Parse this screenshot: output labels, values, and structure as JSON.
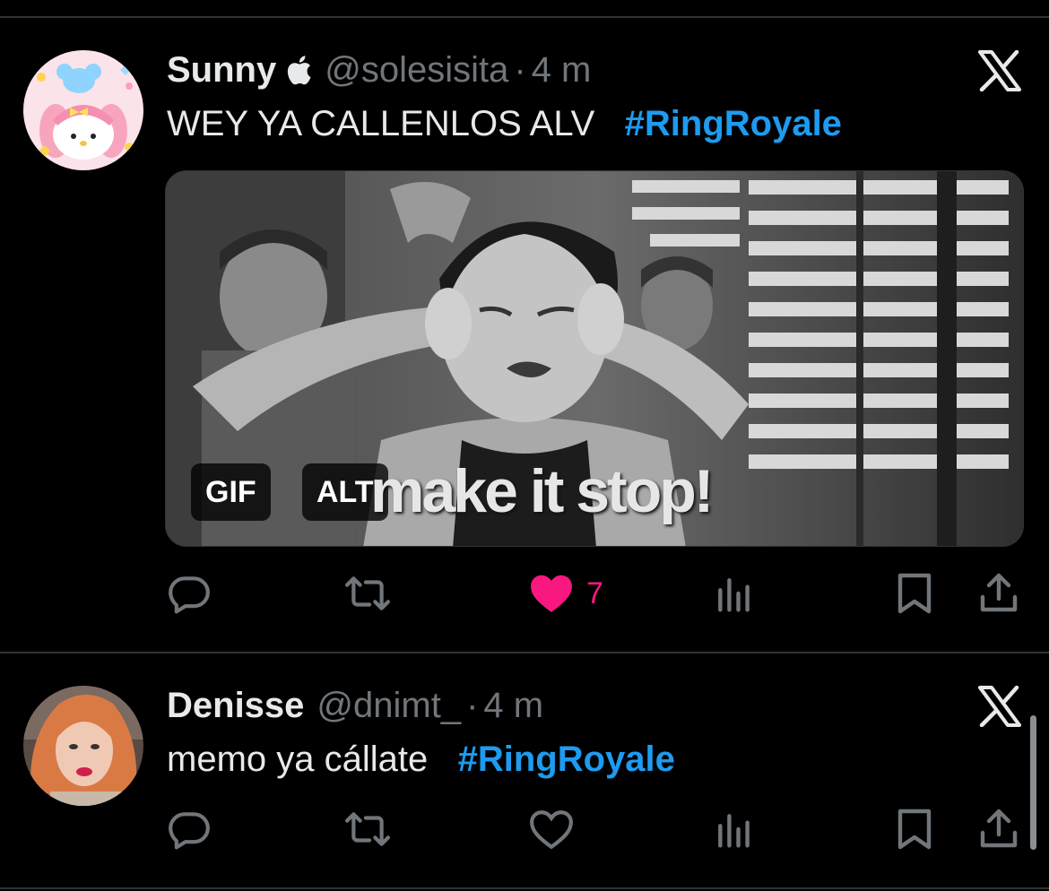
{
  "tweets": [
    {
      "name": "Sunny",
      "badge": "apple-icon",
      "handle": "@solesisita",
      "separator": "·",
      "time": "4 m",
      "text": "WEY YA CALLENLOS ALV",
      "hashtag": "#RingRoyale",
      "media": {
        "caption": "make it stop!",
        "gif_label": "GIF",
        "alt_label": "ALT"
      },
      "likes": "7",
      "liked": true
    },
    {
      "name": "Denisse",
      "handle": "@dnimt_",
      "separator": "·",
      "time": "4 m",
      "text": "memo ya cállate",
      "hashtag": "#RingRoyale",
      "liked": false
    }
  ],
  "colors": {
    "background": "#000000",
    "text": "#e7e9ea",
    "secondary": "#71767b",
    "hashtag": "#1d9bf0",
    "like": "#f91880",
    "divider": "#2f3336"
  },
  "icons": [
    "reply-icon",
    "retweet-icon",
    "like-icon",
    "views-icon",
    "bookmark-icon",
    "share-icon",
    "x-logo-icon"
  ]
}
